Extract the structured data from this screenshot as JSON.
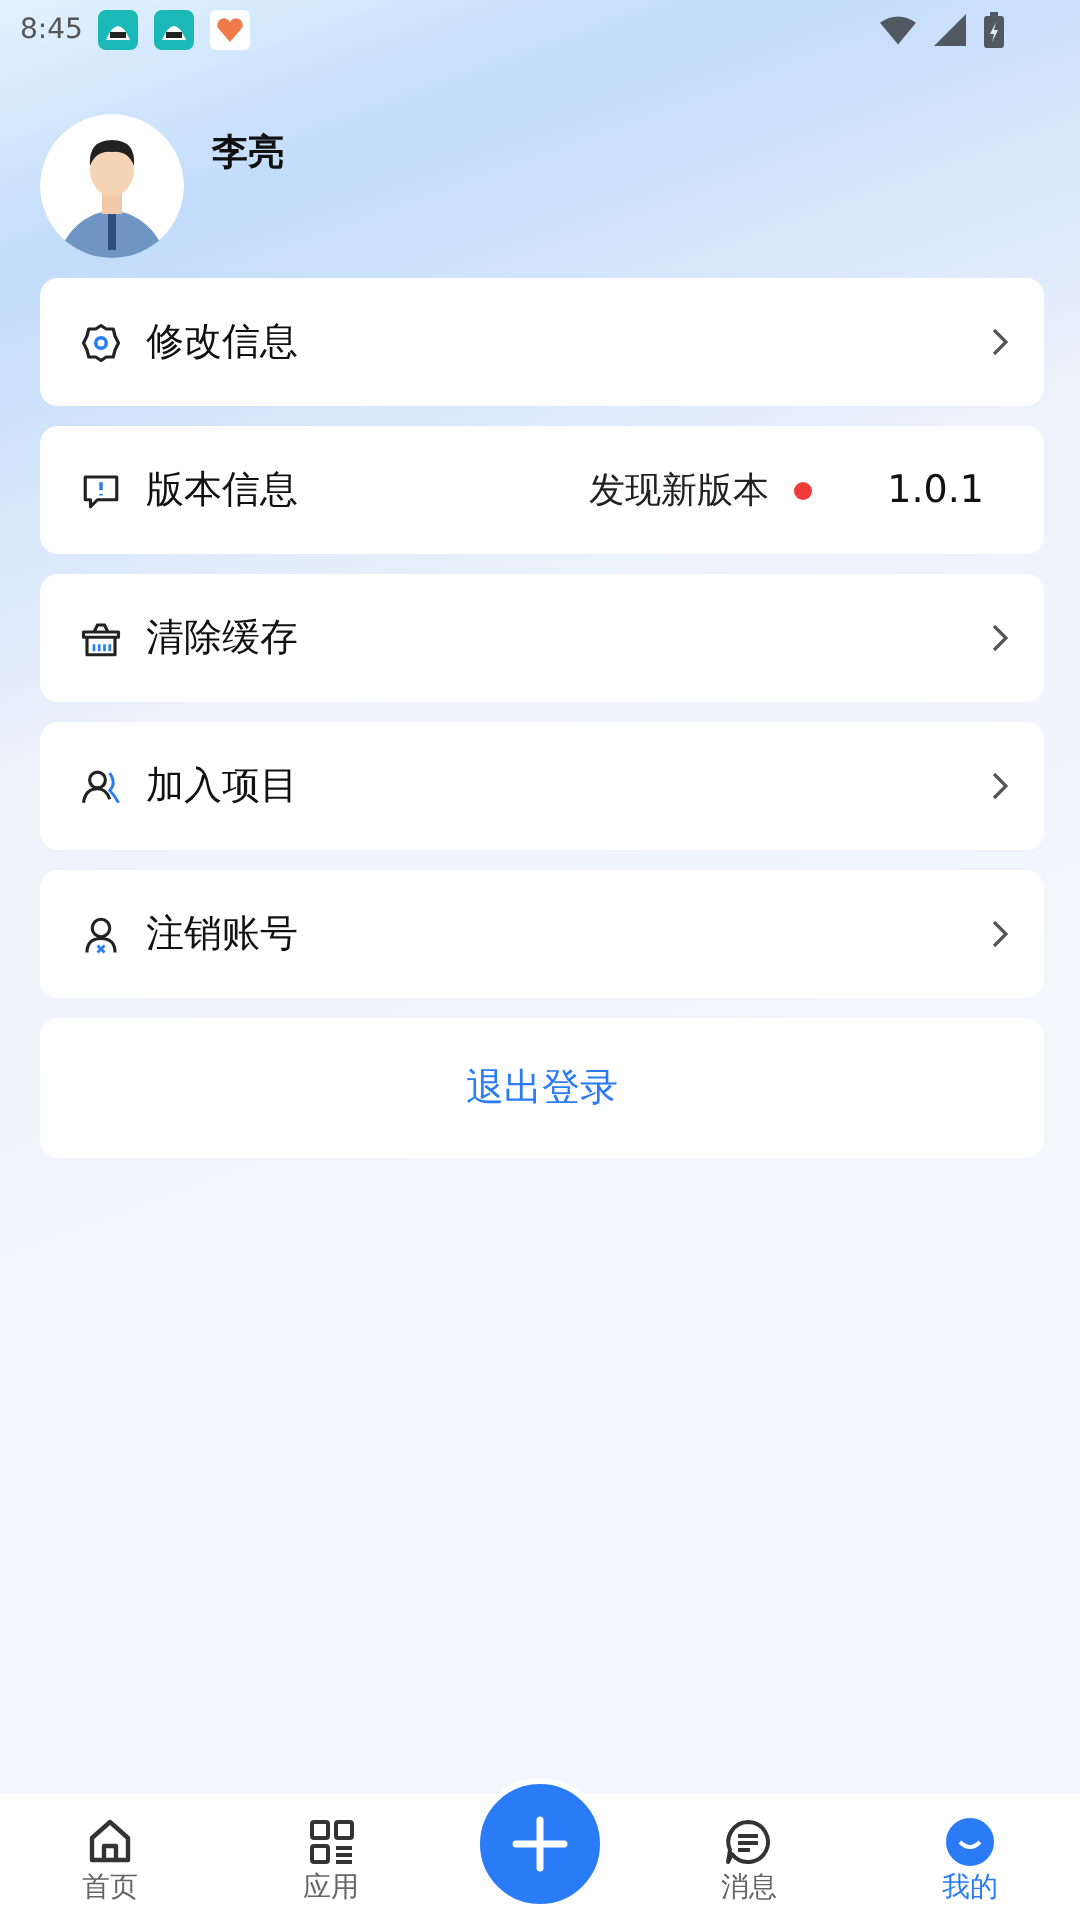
{
  "status_bar": {
    "time": "8:45"
  },
  "profile": {
    "name": "李亮"
  },
  "menu": [
    {
      "kind": "link",
      "label": "修改信息"
    },
    {
      "kind": "version",
      "label": "版本信息",
      "notice": "发现新版本",
      "has_update": true,
      "version": "1.0.1"
    },
    {
      "kind": "link",
      "label": "清除缓存"
    },
    {
      "kind": "link",
      "label": "加入项目"
    },
    {
      "kind": "link",
      "label": "注销账号"
    }
  ],
  "logout_button": "退出登录",
  "tab_bar": [
    {
      "kind": "tab",
      "label": "首页",
      "selected": false
    },
    {
      "kind": "tab",
      "label": "应用",
      "selected": false
    },
    {
      "kind": "add"
    },
    {
      "kind": "tab",
      "label": "消息",
      "selected": false
    },
    {
      "kind": "tab",
      "label": "我的",
      "selected": true
    }
  ]
}
